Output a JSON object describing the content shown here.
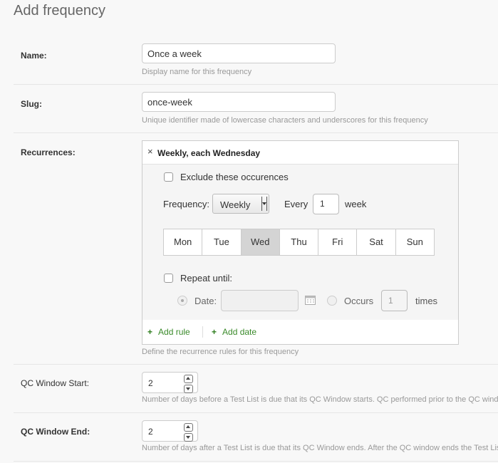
{
  "page": {
    "title": "Add frequency"
  },
  "name_field": {
    "label": "Name:",
    "value": "Once a week",
    "help": "Display name for this frequency"
  },
  "slug_field": {
    "label": "Slug:",
    "value": "once-week",
    "help": "Unique identifier made of lowercase characters and underscores for this frequency"
  },
  "recurrences": {
    "label": "Recurrences:",
    "rule_title": "Weekly, each Wednesday",
    "remove_icon": "×",
    "exclude_label": "Exclude these occurences",
    "exclude_checked": false,
    "frequency_label": "Frequency:",
    "frequency_value": "Weekly",
    "every_label": "Every",
    "interval_value": "1",
    "interval_unit": "week",
    "days": [
      "Mon",
      "Tue",
      "Wed",
      "Thu",
      "Fri",
      "Sat",
      "Sun"
    ],
    "selected_day": "Wed",
    "repeat_until_label": "Repeat until:",
    "repeat_until_checked": false,
    "date_label": "Date:",
    "date_value": "",
    "occurs_label": "Occurs",
    "occurs_value": "1",
    "times_label": "times",
    "add_rule_label": "Add rule",
    "add_date_label": "Add date",
    "add_icon": "+",
    "calendar_icon": "calendar-icon",
    "help": "Define the recurrence rules for this frequency"
  },
  "qc_window_start": {
    "label": "QC Window Start:",
    "value": "2",
    "help": "Number of days before a Test List is due that its QC Window starts. QC performed prior to the QC window"
  },
  "qc_window_end": {
    "label": "QC Window End:",
    "value": "2",
    "help": "Number of days after a Test List is due that its QC Window ends. After the QC window ends the Test List"
  },
  "colors": {
    "accent_green": "#3a8a2a",
    "selected_day": "#d4d4d4",
    "help_text": "#999999"
  }
}
